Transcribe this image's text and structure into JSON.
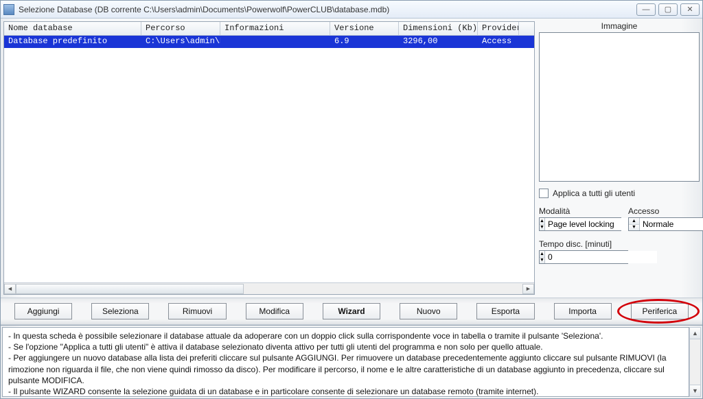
{
  "window": {
    "title": "Selezione Database (DB corrente C:\\Users\\admin\\Documents\\Powerwolf\\PowerCLUB\\database.mdb)"
  },
  "table": {
    "headers": {
      "name": "Nome database",
      "path": "Percorso",
      "info": "Informazioni",
      "version": "Versione",
      "size": "Dimensioni (Kb)",
      "provider": "Provider"
    },
    "rows": [
      {
        "name": "Database predefinito",
        "path": "C:\\Users\\admin\\Doc",
        "info": "",
        "version": "6.9",
        "size": "3296,00",
        "provider": "Access"
      }
    ]
  },
  "side": {
    "image_label": "Immagine",
    "apply_all_label": "Applica a tutti gli utenti",
    "mode_label": "Modalità",
    "mode_value": "Page level locking",
    "access_label": "Accesso",
    "access_value": "Normale",
    "timeout_label": "Tempo disc. [minuti]",
    "timeout_value": "0"
  },
  "buttons": {
    "add": "Aggiungi",
    "select": "Seleziona",
    "remove": "Rimuovi",
    "edit": "Modifica",
    "wizard": "Wizard",
    "new": "Nuovo",
    "export": "Esporta",
    "import": "Importa",
    "device": "Periferica"
  },
  "help": {
    "line1": "- In questa scheda è possibile selezionare il database attuale da adoperare con  un doppio click sulla corrispondente voce in tabella o tramite il pulsante 'Seleziona'.",
    "line2": "- Se l'opzione \"Applica a tutti gli utenti\" è attiva il database selezionato diventa attivo per tutti gli utenti del programma e non solo per quello attuale.",
    "line3": "- Per aggiungere un nuovo database alla lista dei preferiti cliccare sul pulsante AGGIUNGI. Per rimuovere un database precedentemente aggiunto cliccare sul pulsante RIMUOVI (la rimozione non riguarda il file, che non viene quindi rimosso da disco). Per modificare il percorso, il nome e le altre caratteristiche di un database aggiunto in precedenza, cliccare sul pulsante MODIFICA.",
    "line4": "- Il pulsante WIZARD consente la selezione guidata di un database e in particolare consente di selezionare un database remoto (tramite internet)."
  }
}
